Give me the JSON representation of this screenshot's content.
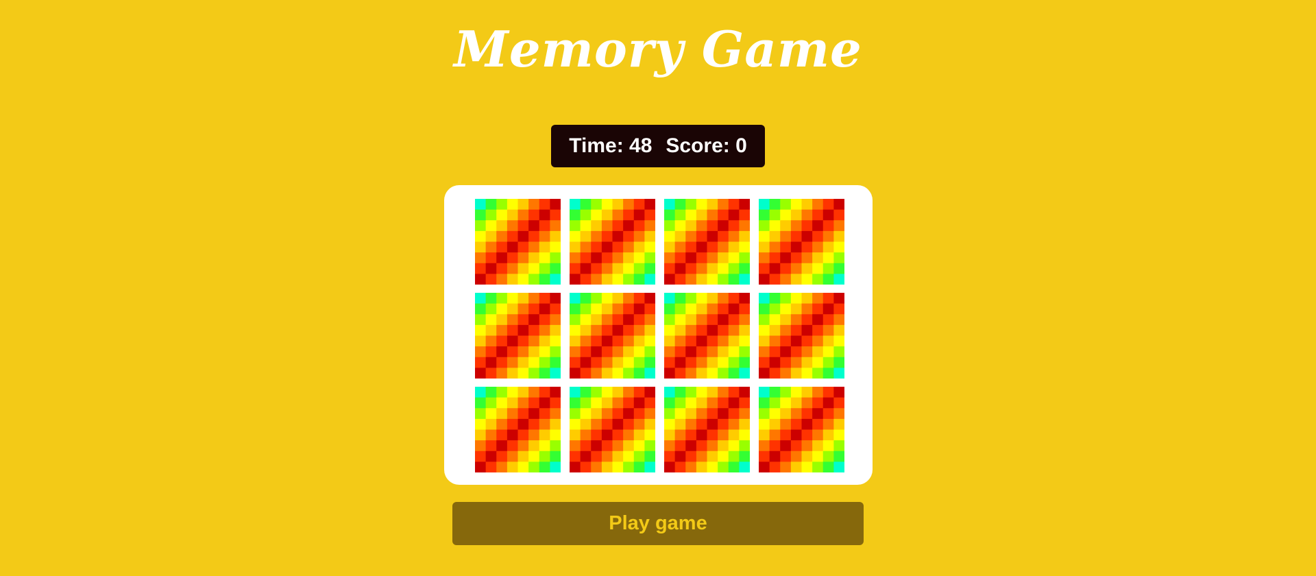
{
  "header": {
    "title": "Memory Game"
  },
  "scoreboard": {
    "time_label": "Time: 48",
    "score_label": "Score: 0"
  },
  "board": {
    "cards": [
      {
        "state": "face-down"
      },
      {
        "state": "face-down"
      },
      {
        "state": "face-down"
      },
      {
        "state": "face-down"
      },
      {
        "state": "face-down"
      },
      {
        "state": "face-down"
      },
      {
        "state": "face-down"
      },
      {
        "state": "face-down"
      },
      {
        "state": "face-down"
      },
      {
        "state": "face-down"
      },
      {
        "state": "face-down"
      },
      {
        "state": "face-down"
      }
    ],
    "card_back_palette": [
      "#cc0000",
      "#ff3300",
      "#ff7700",
      "#ffcc00",
      "#ffff00",
      "#99ff00",
      "#33ff33",
      "#00ffcc",
      "#00aaff",
      "#888888",
      "#aa00ff",
      "#ff0099"
    ]
  },
  "controls": {
    "play_label": "Play game"
  },
  "colors": {
    "background": "#f3ca17",
    "scoreboard_bg": "#1a0505",
    "board_bg": "#ffffff",
    "button_bg": "#86680c",
    "button_text": "#f3ca17"
  }
}
